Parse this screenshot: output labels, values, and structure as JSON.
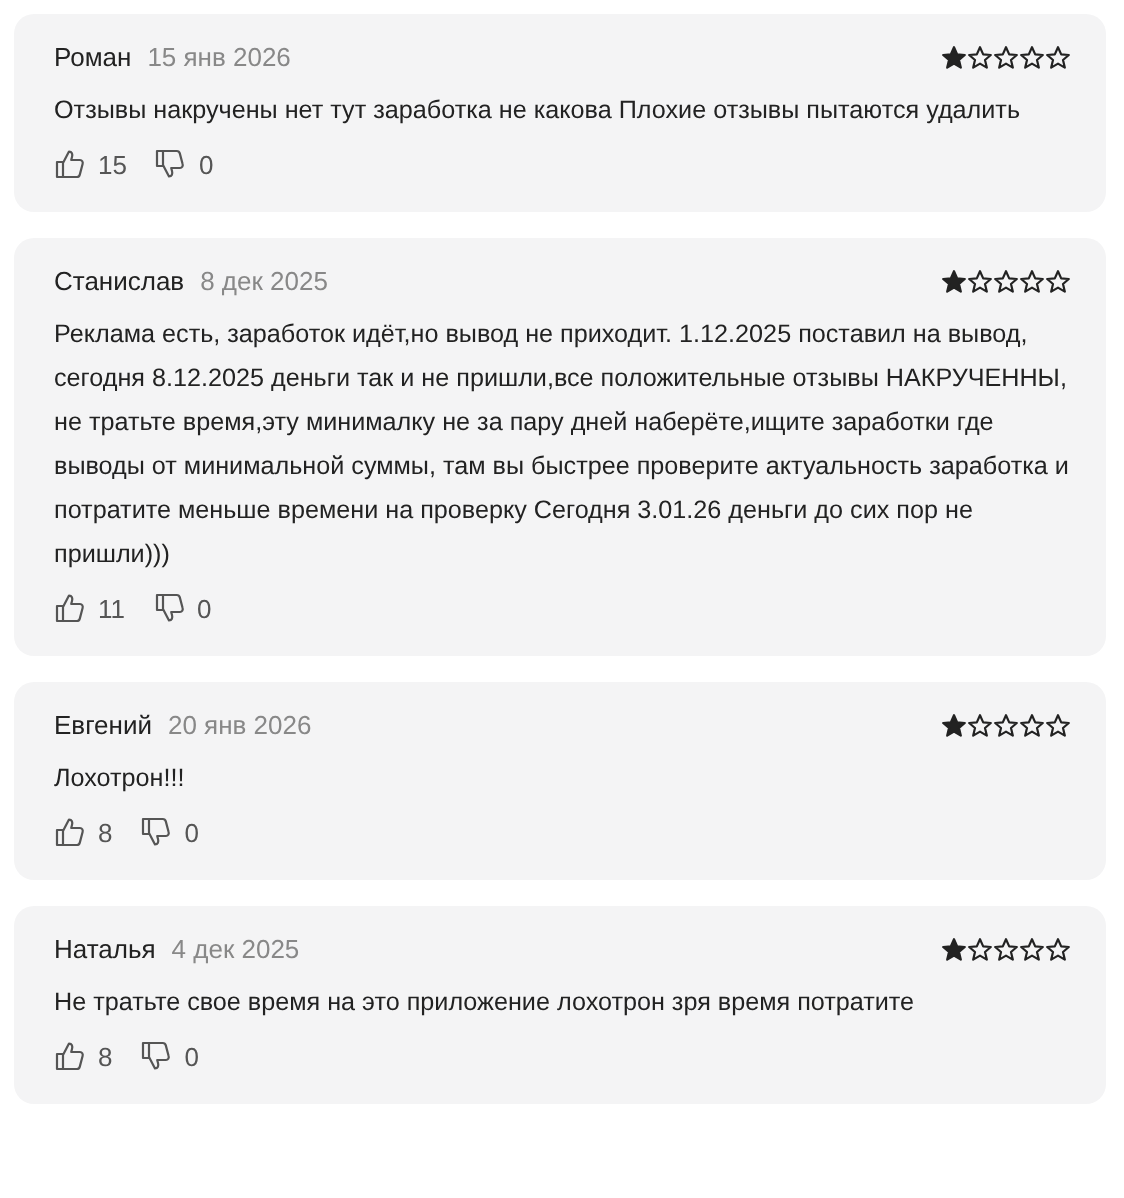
{
  "reviews": [
    {
      "author": "Роман",
      "date": "15 янв 2026",
      "stars": 1,
      "text": "Отзывы накручены нет тут заработка не какова Плохие отзывы пытаются удалить",
      "likes": "15",
      "dislikes": "0"
    },
    {
      "author": "Станислав",
      "date": "8 дек 2025",
      "stars": 1,
      "text": "Реклама есть, заработок идёт,но вывод не приходит. 1.12.2025 поставил на вывод, сегодня 8.12.2025 деньги так и не пришли,все положительные отзывы НАКРУЧЕННЫ, не тратьте время,эту минималку не за пару дней наберёте,ищите заработки где выводы от минимальной суммы, там вы быстрее проверите актуальность заработка и потратите меньше времени на проверку Сегодня 3.01.26 деньги до сих пор не пришли)))",
      "likes": "11",
      "dislikes": "0"
    },
    {
      "author": "Евгений",
      "date": "20 янв 2026",
      "stars": 1,
      "text": "Лохотрон!!!",
      "likes": "8",
      "dislikes": "0"
    },
    {
      "author": "Наталья",
      "date": "4 дек 2025",
      "stars": 1,
      "text": "Не тратьте свое время на это приложение лохотрон зря время потратите",
      "likes": "8",
      "dislikes": "0"
    }
  ]
}
